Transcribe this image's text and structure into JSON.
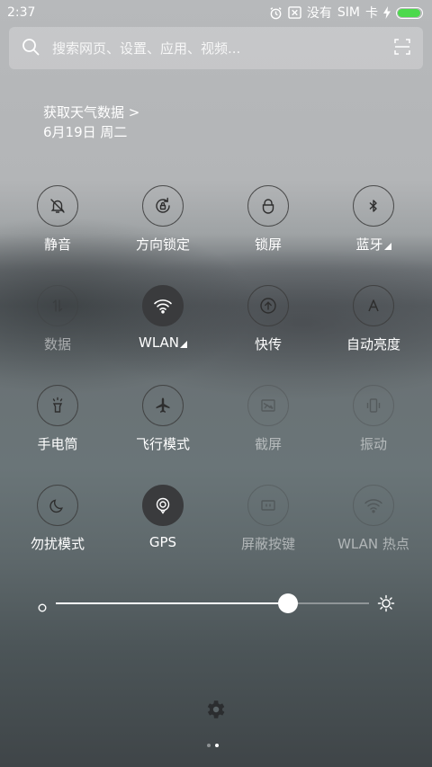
{
  "status_bar": {
    "time": "2:37",
    "no_label": "没有",
    "sim_label": "SIM",
    "card_label": "卡",
    "battery_level": 0.95,
    "battery_color": "#4cd94c"
  },
  "search": {
    "placeholder": "搜索网页、设置、应用、视频...",
    "left_icon": "search-icon",
    "right_icon": "scan-icon"
  },
  "weather": {
    "link_text": "获取天气数据 >",
    "date_text": "6月19日 周二"
  },
  "toggles": [
    {
      "label": "静音",
      "icon": "bell-mute-icon",
      "state": "off"
    },
    {
      "label": "方向锁定",
      "icon": "rotation-lock-icon",
      "state": "off"
    },
    {
      "label": "锁屏",
      "icon": "lock-icon",
      "state": "off"
    },
    {
      "label": "蓝牙",
      "icon": "bluetooth-icon",
      "state": "off",
      "expandable": true
    },
    {
      "label": "数据",
      "icon": "data-icon",
      "state": "disabled"
    },
    {
      "label": "WLAN",
      "icon": "wifi-icon",
      "state": "on",
      "expandable": true
    },
    {
      "label": "快传",
      "icon": "quick-transfer-icon",
      "state": "off"
    },
    {
      "label": "自动亮度",
      "icon": "auto-brightness-icon",
      "state": "off"
    },
    {
      "label": "手电筒",
      "icon": "flashlight-icon",
      "state": "off"
    },
    {
      "label": "飞行模式",
      "icon": "airplane-icon",
      "state": "off"
    },
    {
      "label": "截屏",
      "icon": "screenshot-icon",
      "state": "disabled"
    },
    {
      "label": "振动",
      "icon": "vibrate-icon",
      "state": "disabled"
    },
    {
      "label": "勿扰模式",
      "icon": "moon-icon",
      "state": "off"
    },
    {
      "label": "GPS",
      "icon": "gps-icon",
      "state": "on"
    },
    {
      "label": "屏蔽按键",
      "icon": "block-keys-icon",
      "state": "disabled"
    },
    {
      "label": "WLAN 热点",
      "icon": "hotspot-icon",
      "state": "disabled"
    }
  ],
  "brightness": {
    "level": 0.74,
    "min_icon": "brightness-low-icon",
    "max_icon": "sun-icon"
  },
  "footer": {
    "settings_icon": "gear-icon",
    "page_count": 2,
    "active_page": 2
  }
}
